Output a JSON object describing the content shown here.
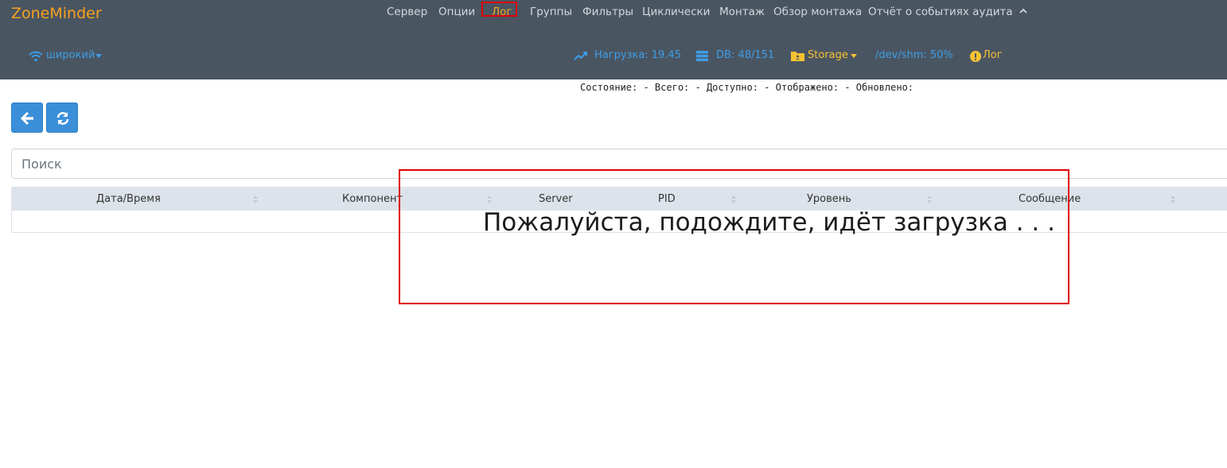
{
  "brand": "ZoneMinder",
  "menu": [
    {
      "label": "Сервер",
      "active": false
    },
    {
      "label": "Опции",
      "active": false
    },
    {
      "label": "Лог",
      "active": true
    },
    {
      "label": "Группы",
      "active": false
    },
    {
      "label": "Фильтры",
      "active": false
    },
    {
      "label": "Циклически",
      "active": false
    },
    {
      "label": "Монтаж",
      "active": false
    },
    {
      "label": "Обзор монтажа",
      "active": false
    },
    {
      "label": "Отчёт о событиях аудита",
      "active": false
    }
  ],
  "toolbar": {
    "bandwidth": "широкий",
    "load": "Нагрузка: 19.45",
    "db": "DB: 48/151",
    "storage": "Storage",
    "shm": "/dev/shm: 50%",
    "log": "Лог"
  },
  "status_line": "Состояние: - Всего: - Доступно: - Отображено: - Обновлено:",
  "search": {
    "placeholder": "Поиск"
  },
  "table": {
    "columns": [
      "Дата/Время",
      "Компонент",
      "Server",
      "PID",
      "Уровень",
      "Сообщение"
    ]
  },
  "loading": {
    "text": "Пожалуйста, подождите, идёт загрузка",
    "dots": ". . ."
  },
  "colors": {
    "navbar": "#4a5562",
    "brand": "#f7a21b",
    "link": "#3d9ee7",
    "button": "#3b8fd9",
    "highlight": "#e00000"
  }
}
